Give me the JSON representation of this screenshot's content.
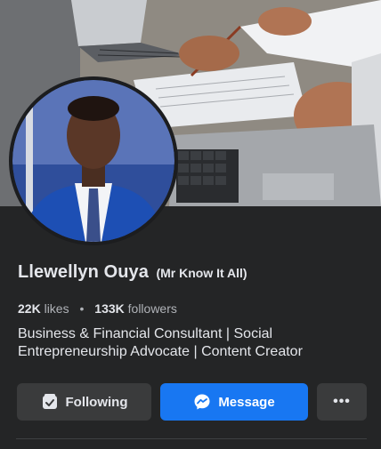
{
  "profile": {
    "name": "Llewellyn Ouya",
    "nickname": "(Mr Know It All)",
    "likes_count": "22K",
    "likes_label": "likes",
    "separator": "•",
    "followers_count": "133K",
    "followers_label": "followers",
    "bio_line1": "Business & Financial Consultant | Social",
    "bio_line2": "Entrepreneurship Advocate | Content Creator"
  },
  "actions": {
    "following_label": "Following",
    "message_label": "Message",
    "more_label": "•••"
  },
  "icons": {
    "following": "following-check-icon",
    "message": "messenger-icon",
    "more": "more-dots-icon"
  },
  "colors": {
    "background": "#242526",
    "primary_button": "#1877f2",
    "secondary_button": "#3a3b3c",
    "text_primary": "#e4e6eb",
    "text_secondary": "#b0b3b8"
  }
}
